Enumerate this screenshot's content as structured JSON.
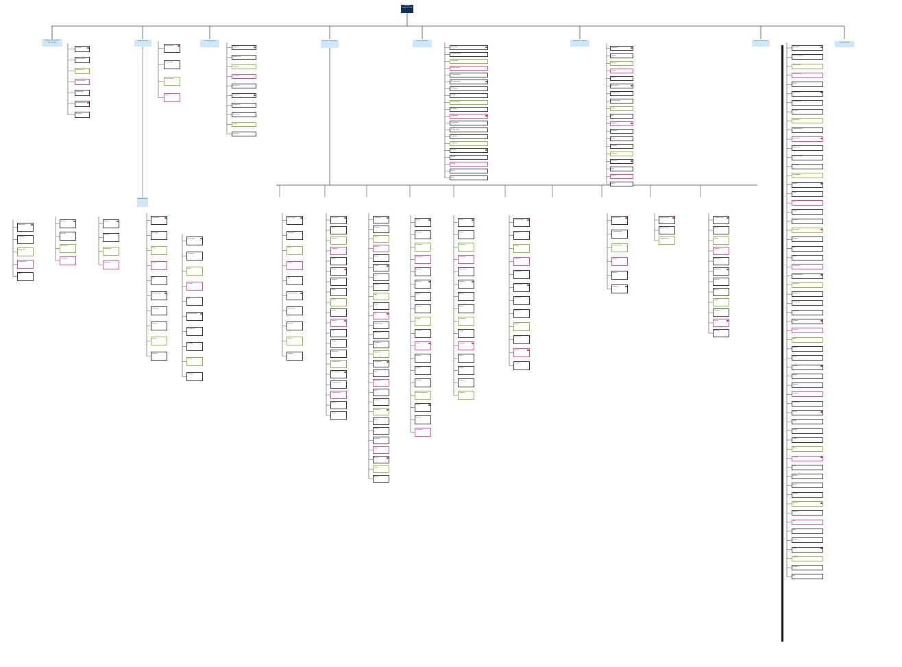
{
  "root": {
    "title": "Flexible Budgeting Toolkit"
  },
  "categories": [
    {
      "label": "Financial Reporting & Management"
    },
    {
      "label": "Budget Analysis"
    },
    {
      "label": "Cost Management"
    },
    {
      "label": "Revenue Forecasting"
    },
    {
      "label": "Variance Analysis"
    },
    {
      "label": "Performance Metrics"
    },
    {
      "label": "Resource Allocation"
    },
    {
      "label": "Planning Tools"
    },
    {
      "label": "External Data"
    }
  ],
  "branches": {
    "b0": [
      "Cash flow",
      "Budget vs actual",
      "Rolling forecast",
      "Expense tracking",
      "Capital budget",
      "Department costs",
      "Summary"
    ],
    "b1": [
      "Budget template",
      "Cost allocation",
      "Forecast model",
      "Review"
    ],
    "b2": [
      "Fixed costs",
      "Variable costs",
      "Overheads",
      "Cost drivers",
      "Cost centers",
      "Cost review",
      "Savings plan",
      "Procurement",
      "Vendors",
      "Cost report"
    ],
    "b4": [
      "Sales budget",
      "Production budget",
      "Labor budget",
      "Material budget",
      "Overhead budget",
      "Marketing budget",
      "R&D budget",
      "IT budget",
      "Facilities budget",
      "HR budget",
      "Legal budget",
      "Travel budget",
      "Training budget",
      "Capital plan",
      "Contingency",
      "Reporting",
      "Approval",
      "Revision",
      "Archive",
      "Audit"
    ],
    "b5": [
      "Profitability",
      "Liquidity",
      "Efficiency",
      "Leverage",
      "Growth",
      "Market share",
      "Customer value",
      "Employee output",
      "Quality",
      "Risk",
      "Compliance",
      "Benchmark",
      "Targets",
      "KPI review",
      "Dashboard",
      "Scorecard",
      "Trend",
      "Forecast",
      "Report"
    ],
    "b6": [
      "Staff",
      "Equipment",
      "Space",
      "Funding",
      "Time",
      "Projects",
      "Priorities",
      "Capacity",
      "Utilization",
      "Constraints",
      "Tradeoffs",
      "Scenarios",
      "Approval",
      "Review"
    ],
    "b8": [
      "Market data",
      "Economic indicators",
      "Industry reports",
      "Competitor data",
      "Inflation",
      "Interest rates",
      "Exchange rates",
      "Tax rates",
      "Regulations",
      "Commodity prices",
      "Labor market",
      "Supply chain",
      "Consumer trends",
      "Technology",
      "Demographics",
      "Weather",
      "Policy",
      "News",
      "Surveys",
      "Research",
      "Benchmarks",
      "Databases",
      "APIs",
      "Feeds",
      "Publications",
      "Government data",
      "Trade data",
      "Energy prices",
      "Housing data",
      "Credit data",
      "Sentiment",
      "Forecasts",
      "Models",
      "Archives",
      "Sources",
      "Citations",
      "Updates",
      "Validation",
      "Integration",
      "Governance",
      "Security",
      "Quality",
      "Lineage",
      "Catalog",
      "Access",
      "Licensing",
      "Costs",
      "Vendors",
      "Review",
      "Summary",
      "Appendix",
      "Glossary",
      "Index",
      "Notes",
      "Contacts",
      "History",
      "Changes",
      "Feedback",
      "End"
    ]
  },
  "colors": {
    "root": "#0f2a5c",
    "category": "#cfe8f7",
    "line": "#333333",
    "pink": "#e0479a",
    "green": "#8ab83a",
    "link": "#3a6fd6",
    "badge": "#c0202a"
  }
}
